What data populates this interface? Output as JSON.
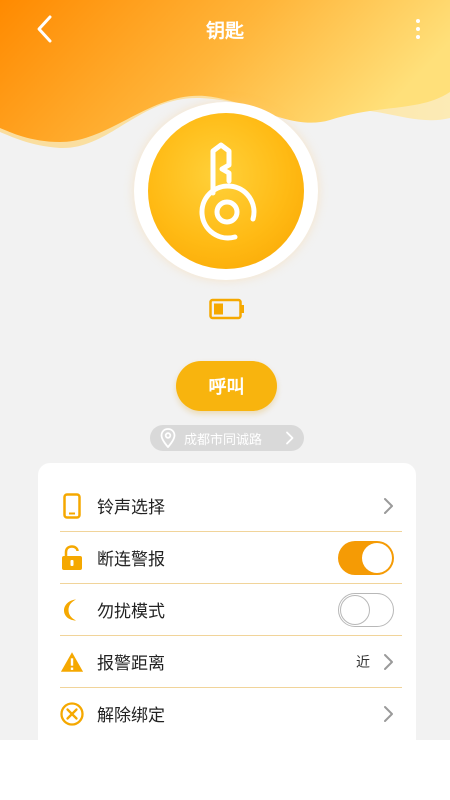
{
  "header": {
    "title": "钥匙",
    "back_icon": "chevron-left-icon",
    "more_icon": "more-vertical-icon"
  },
  "device": {
    "icon": "key-icon",
    "battery_icon": "battery-low-icon",
    "battery_level": 0.3
  },
  "call_button": {
    "label": "呼叫"
  },
  "location": {
    "icon": "location-pin-icon",
    "text": "成都市同诚路"
  },
  "settings": [
    {
      "label": "铃声选择",
      "icon": "phone-icon",
      "type": "link",
      "value": ""
    },
    {
      "label": "断连警报",
      "icon": "lock-icon",
      "type": "toggle",
      "on": true
    },
    {
      "label": "勿扰模式",
      "icon": "moon-icon",
      "type": "toggle",
      "on": false
    },
    {
      "label": "报警距离",
      "icon": "warning-icon",
      "type": "link",
      "value": "近"
    },
    {
      "label": "解除绑定",
      "icon": "unbind-icon",
      "type": "link",
      "value": ""
    }
  ],
  "colors": {
    "accent": "#f8b40e",
    "toggle_on": "#f59b05",
    "header_start": "#ff8a00",
    "header_end": "#ffe07a"
  }
}
